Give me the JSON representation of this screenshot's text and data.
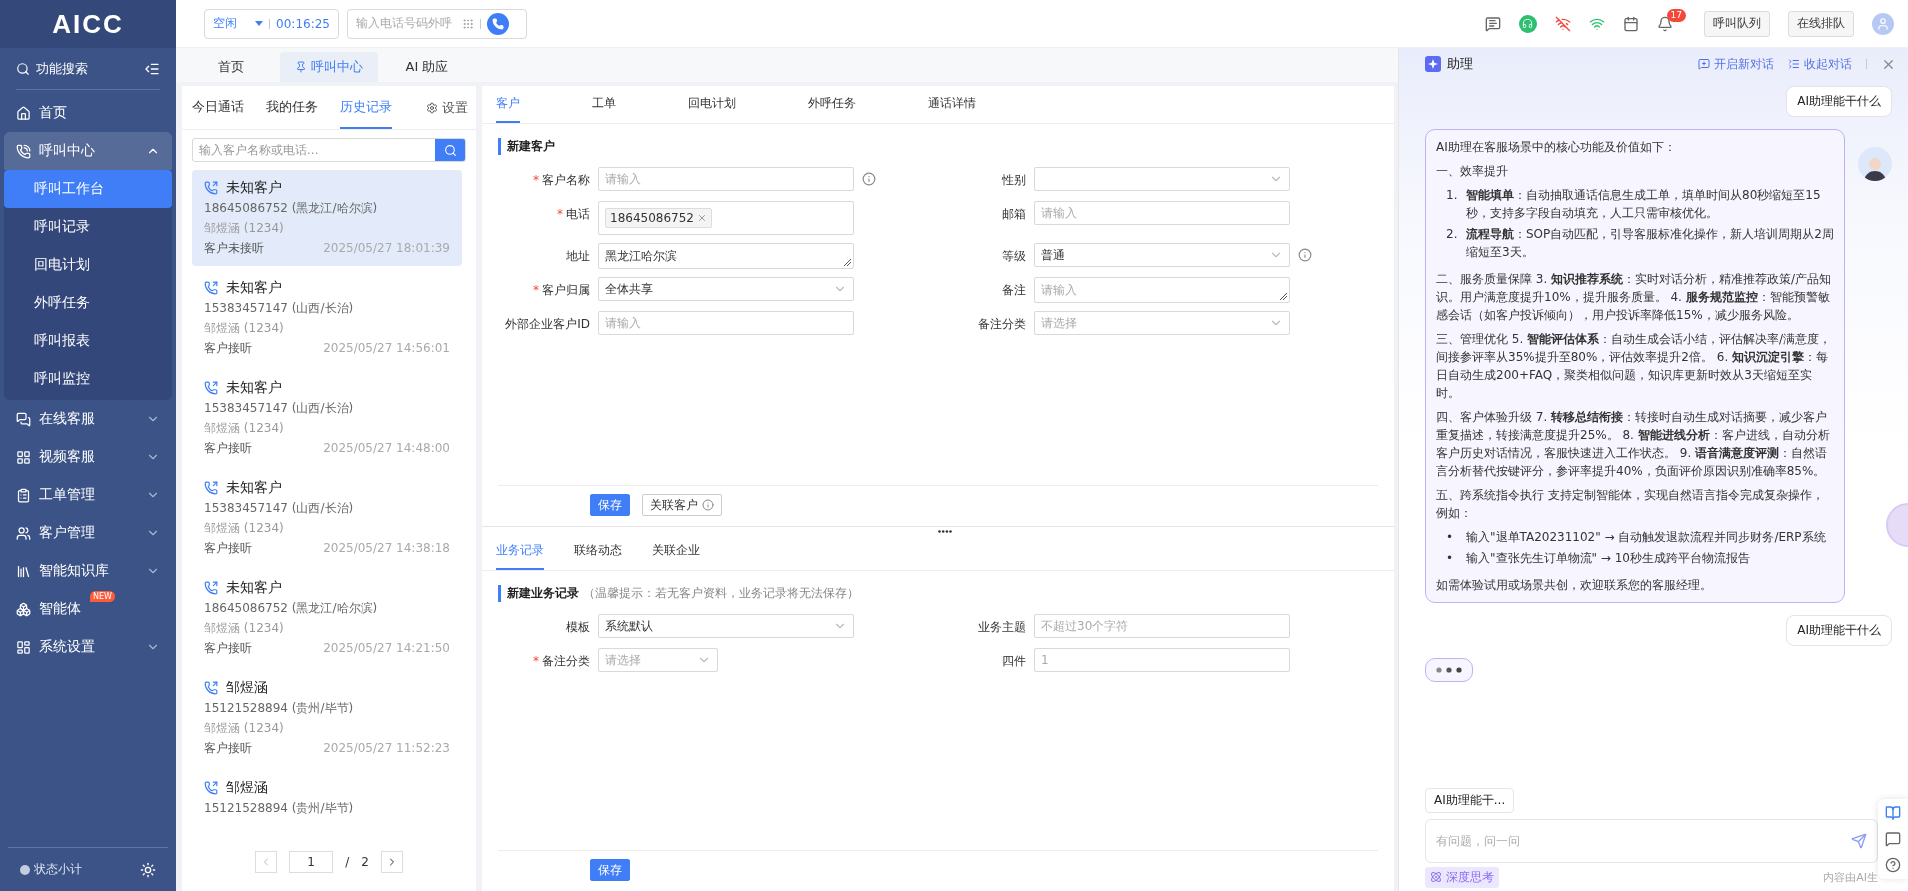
{
  "brand": "AICC",
  "sidebar": {
    "search": "功能搜索",
    "items": [
      {
        "kind": "link",
        "label": "首页",
        "selected": false
      },
      {
        "kind": "group",
        "label": "呼叫中心",
        "expanded": true,
        "children": [
          {
            "label": "呼叫工作台",
            "selected": true
          },
          {
            "label": "呼叫记录",
            "selected": false
          },
          {
            "label": "回电计划",
            "selected": false
          },
          {
            "label": "外呼任务",
            "selected": false
          },
          {
            "label": "呼叫报表",
            "selected": false
          },
          {
            "label": "呼叫监控",
            "selected": false
          }
        ]
      },
      {
        "kind": "group",
        "label": "在线客服",
        "expanded": false
      },
      {
        "kind": "group",
        "label": "视频客服",
        "expanded": false
      },
      {
        "kind": "group",
        "label": "工单管理",
        "expanded": false
      },
      {
        "kind": "group",
        "label": "客户管理",
        "expanded": false
      },
      {
        "kind": "group",
        "label": "智能知识库",
        "expanded": false
      },
      {
        "kind": "link",
        "label": "智能体",
        "selected": false,
        "badge": "NEW"
      },
      {
        "kind": "group",
        "label": "系统设置",
        "expanded": false
      }
    ],
    "footer": "状态小计"
  },
  "topbar": {
    "status": "空闲",
    "timer": "00:16:25",
    "dial_placeholder": "输入电话号码外呼",
    "notification_count": "17",
    "buttons": [
      "呼叫队列",
      "在线排队"
    ]
  },
  "page_tabs": [
    {
      "label": "首页",
      "selected": false
    },
    {
      "label": "呼叫中心",
      "selected": true
    },
    {
      "label": "AI 助应",
      "selected": false
    }
  ],
  "history": {
    "tabs": [
      {
        "label": "今日通话",
        "selected": false
      },
      {
        "label": "我的任务",
        "selected": false
      },
      {
        "label": "历史记录",
        "selected": true
      }
    ],
    "settings": "设置",
    "search_placeholder": "输入客户名称或电话...",
    "records": [
      {
        "name": "未知客户",
        "phone": "18645086752 (黑龙江/哈尔滨)",
        "agent": "邹煜涵 (1234)",
        "status": "客户未接听",
        "time": "2025/05/27 18:01:39",
        "selected": true
      },
      {
        "name": "未知客户",
        "phone": "15383457147 (山西/长治)",
        "agent": "邹煜涵 (1234)",
        "status": "客户接听",
        "time": "2025/05/27 14:56:01",
        "selected": false
      },
      {
        "name": "未知客户",
        "phone": "15383457147 (山西/长治)",
        "agent": "邹煜涵 (1234)",
        "status": "客户接听",
        "time": "2025/05/27 14:48:00",
        "selected": false
      },
      {
        "name": "未知客户",
        "phone": "15383457147 (山西/长治)",
        "agent": "邹煜涵 (1234)",
        "status": "客户接听",
        "time": "2025/05/27 14:38:18",
        "selected": false
      },
      {
        "name": "未知客户",
        "phone": "18645086752 (黑龙江/哈尔滨)",
        "agent": "邹煜涵 (1234)",
        "status": "客户接听",
        "time": "2025/05/27 14:21:50",
        "selected": false
      },
      {
        "name": "邹煜涵",
        "phone": "15121528894 (贵州/毕节)",
        "agent": "邹煜涵 (1234)",
        "status": "客户接听",
        "time": "2025/05/27 11:52:23",
        "selected": false
      },
      {
        "name": "邹煜涵",
        "phone": "15121528894 (贵州/毕节)",
        "selected": false
      }
    ],
    "pagination": {
      "page": "1",
      "separator": "/",
      "total": "2"
    }
  },
  "customer_tabs": [
    {
      "label": "客户",
      "selected": true
    },
    {
      "label": "工单",
      "selected": false
    },
    {
      "label": "回电计划",
      "selected": false
    },
    {
      "label": "外呼任务",
      "selected": false
    },
    {
      "label": "通话详情",
      "selected": false
    }
  ],
  "customer_form": {
    "title": "新建客户",
    "fields": [
      {
        "kind": "input",
        "label": "客户名称",
        "required_mark": "*",
        "placeholder": "请输入",
        "info": true
      },
      {
        "kind": "select",
        "label": "性别"
      },
      {
        "kind": "tags",
        "label": "电话",
        "required_mark": "*",
        "tags": [
          "18645086752"
        ]
      },
      {
        "kind": "input",
        "label": "邮箱",
        "placeholder": "请输入"
      },
      {
        "kind": "textarea",
        "label": "地址",
        "value": "黑龙江哈尔滨"
      },
      {
        "kind": "select",
        "label": "等级",
        "value": "普通",
        "info": true
      },
      {
        "kind": "select",
        "label": "客户归属",
        "required_mark": "*",
        "value": "全体共享"
      },
      {
        "kind": "textarea",
        "label": "备注",
        "placeholder": "请输入"
      },
      {
        "kind": "input",
        "label": "外部企业客户ID",
        "placeholder": "请输入"
      },
      {
        "kind": "select",
        "label": "备注分类",
        "placeholder": "请选择"
      }
    ],
    "buttons": [
      {
        "kind": "primary",
        "label": "保存"
      },
      {
        "kind": "info",
        "label": "关联客户"
      }
    ]
  },
  "record_tabs": [
    {
      "label": "业务记录",
      "selected": true
    },
    {
      "label": "联络动态",
      "selected": false
    },
    {
      "label": "关联企业",
      "selected": false
    }
  ],
  "record_form": {
    "title": "新建业务记录",
    "hint": "（温馨提示：若无客户资料，业务记录将无法保存）",
    "fields": [
      {
        "kind": "select",
        "label": "模板",
        "value": "系统默认"
      },
      {
        "kind": "input",
        "label": "业务主题",
        "placeholder": "不超过30个字符"
      },
      {
        "kind": "select",
        "label": "备注分类",
        "required_mark": "*",
        "placeholder": "请选择",
        "compact": true
      },
      {
        "kind": "input",
        "label": "四件",
        "placeholder": "1"
      }
    ],
    "buttons": [
      {
        "kind": "primary",
        "label": "保存"
      }
    ]
  },
  "assistant": {
    "title": "助理",
    "actions": [
      "开启新对话",
      "收起对话"
    ],
    "messages": [
      {
        "kind": "user",
        "text": "AI助理能干什么"
      },
      {
        "kind": "bot",
        "blocks": [
          {
            "kind": "paragraph",
            "text": "AI助理在客服场景中的核心功能及价值如下："
          },
          {
            "kind": "paragraph",
            "text": "一、效率提升"
          },
          {
            "kind": "ordered",
            "items": [
              {
                "marker": "1.",
                "text": "**智能填单**：自动抽取通话信息生成工单，填单时间从80秒缩短至15秒，支持多字段自动填充，人工只需审核优化。"
              },
              {
                "marker": "2.",
                "text": "**流程导航**：SOP自动匹配，引导客服标准化操作，新人培训周期从2周缩短至3天。"
              }
            ]
          },
          {
            "kind": "paragraph",
            "text": "二、服务质量保障 3. **知识推荐系统**：实时对话分析，精准推荐政策/产品知识。用户满意度提升10%，提升服务质量。 4. **服务规范监控**：智能预警敏感会话（如客户投诉倾向），用户投诉率降低15%，减少服务风险。"
          },
          {
            "kind": "paragraph",
            "text": "三、管理优化 5. **智能评估体系**：自动生成会话小结，评估解决率/满意度，间接参评率从35%提升至80%，评估效率提升2倍。 6. **知识沉淀引擎**：每日自动生成200+FAQ，聚类相似问题，知识库更新时效从3天缩短至实时。"
          },
          {
            "kind": "paragraph",
            "text": "四、客户体验升级 7. **转移总结衔接**：转接时自动生成对话摘要，减少客户重复描述，转接满意度提升25%。 8. **智能进线分析**：客户进线，自动分析客户历史对话情况，客服快速进入工作状态。 9. **语音满意度评测**：自然语言分析替代按键评分，参评率提升40%，负面评价原因识别准确率85%。"
          },
          {
            "kind": "paragraph",
            "text": "五、跨系统指令执行 支持定制智能体，实现自然语言指令完成复杂操作，例如："
          },
          {
            "kind": "bullets",
            "items": [
              {
                "marker": "•",
                "text": "输入\"退单TA20231102\" → 自动触发退款流程并同步财务/ERP系统"
              },
              {
                "marker": "•",
                "text": "输入\"查张先生订单物流\" → 10秒生成跨平台物流报告"
              }
            ]
          },
          {
            "kind": "paragraph",
            "text": "如需体验试用或场景共创，欢迎联系您的客服经理。"
          }
        ]
      },
      {
        "kind": "user",
        "text": "AI助理能干什么"
      },
      {
        "kind": "typing"
      }
    ],
    "quick_prompt": "AI助理能干...",
    "input_placeholder": "有问题，问一问",
    "deep_think": {
      "label": "深度思考",
      "on": true
    },
    "disclaimer": "内容由AI生"
  }
}
